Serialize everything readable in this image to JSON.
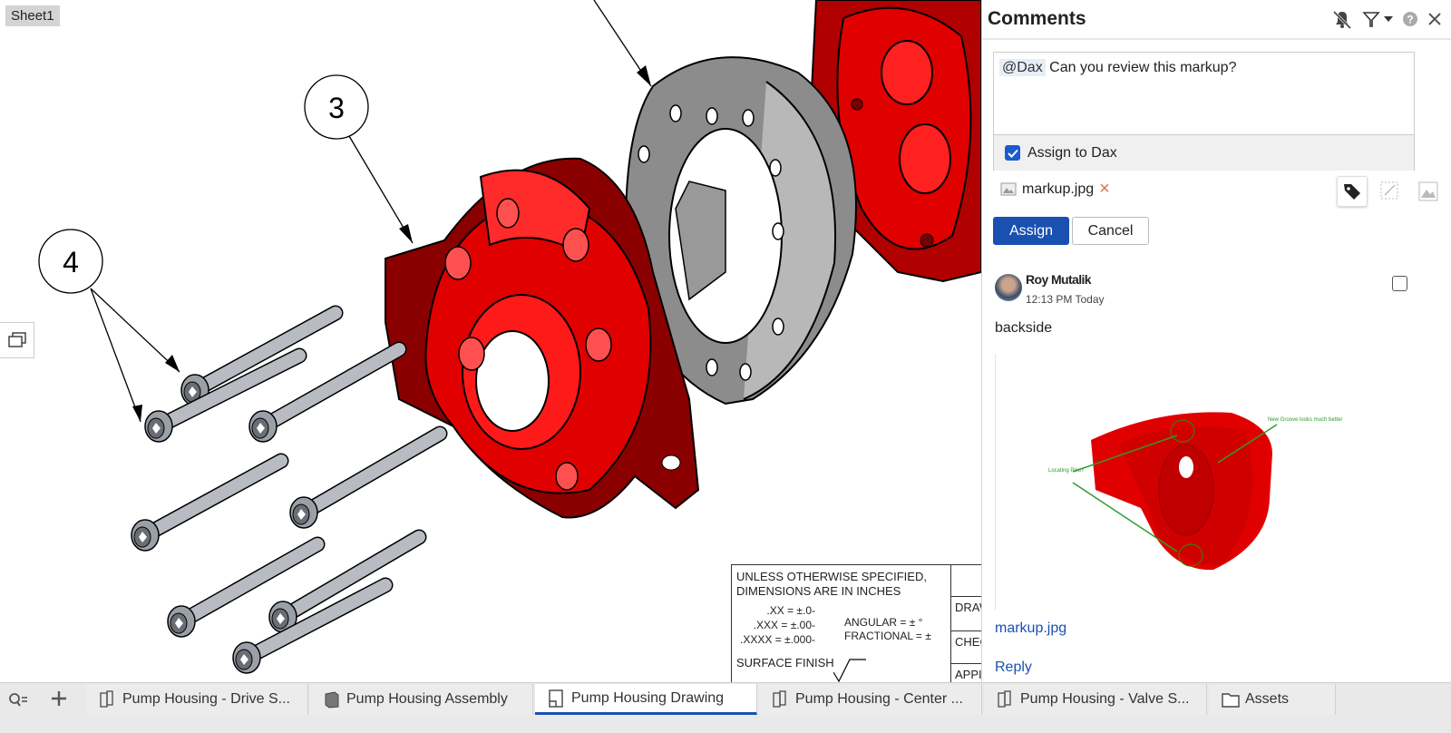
{
  "canvas": {
    "sheet_label": "Sheet1",
    "balloons": [
      "3",
      "4"
    ],
    "title_block": {
      "lines": [
        "UNLESS OTHERWISE SPECIFIED,",
        "DIMENSIONS ARE IN INCHES"
      ],
      "tolerances": [
        ".XX = ±.0-",
        ".XXX = ±.00-",
        ".XXXX = ±.000-"
      ],
      "angular": "ANGULAR = ± °",
      "fractional": "FRACTIONAL = ±",
      "surface_finish": "SURFACE FINISH",
      "right_cells": [
        "DRAW",
        "CHEC",
        "APPI"
      ]
    },
    "colors": {
      "part_red": "#e00000",
      "part_dark": "#8a0000",
      "ring_gray": "#8c8c8c",
      "bolt": "#b8bcc2"
    }
  },
  "panel": {
    "title": "Comments",
    "icons": [
      "bell-muted-icon",
      "filter-icon",
      "caret-down-icon",
      "help-icon",
      "close-icon"
    ],
    "compose": {
      "mention": "@Dax",
      "text": "Can you review this markup?",
      "assign_label": "Assign to Dax",
      "assign_checked": true
    },
    "attachment": {
      "filename": "markup.jpg",
      "remove": "×"
    },
    "buttons": {
      "assign": "Assign",
      "cancel": "Cancel"
    },
    "comment": {
      "author": "Roy Mutalik",
      "time": "12:13 PM Today",
      "body": "backside",
      "image_notes": [
        "Locating Pins?",
        "New Groove looks much better"
      ],
      "attachment": "markup.jpg",
      "reply": "Reply"
    },
    "accent": "#1a50b0"
  },
  "tabs": [
    {
      "label": "Pump Housing - Drive S...",
      "icon": "part-studio-icon"
    },
    {
      "label": "Pump Housing Assembly",
      "icon": "assembly-icon"
    },
    {
      "label": "Pump Housing Drawing",
      "icon": "drawing-icon",
      "active": true
    },
    {
      "label": "Pump Housing - Center ...",
      "icon": "part-studio-icon"
    },
    {
      "label": "Pump Housing - Valve S...",
      "icon": "part-studio-icon"
    },
    {
      "label": "Assets",
      "icon": "folder-icon"
    }
  ]
}
